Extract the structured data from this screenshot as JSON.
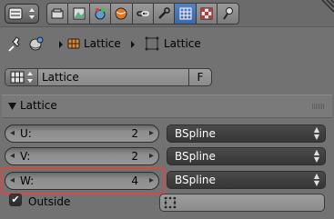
{
  "tabs": [
    {
      "icon": "render-layers-icon",
      "active": false
    },
    {
      "icon": "scene-icon",
      "active": false
    },
    {
      "icon": "world-icon",
      "active": false
    },
    {
      "icon": "object-icon",
      "active": false
    },
    {
      "icon": "constraints-icon",
      "active": false
    },
    {
      "icon": "modifiers-icon",
      "active": false
    },
    {
      "icon": "lattice-data-icon",
      "active": true
    },
    {
      "icon": "texture-icon",
      "active": false
    },
    {
      "icon": "physics-icon",
      "active": false
    }
  ],
  "breadcrumb": {
    "object": "Lattice",
    "data": "Lattice"
  },
  "datablock": {
    "name": "Lattice",
    "fake_user": "F"
  },
  "panel": {
    "title": "Lattice",
    "rows": [
      {
        "label": "U:",
        "value": "2",
        "interp": "BSpline"
      },
      {
        "label": "V:",
        "value": "2",
        "interp": "BSpline"
      },
      {
        "label": "W:",
        "value": "4",
        "interp": "BSpline"
      }
    ],
    "outside_label": "Outside",
    "outside_checked": true,
    "colors": {
      "highlight": "#d24b4b",
      "active_tab": "#4a74b8"
    }
  }
}
